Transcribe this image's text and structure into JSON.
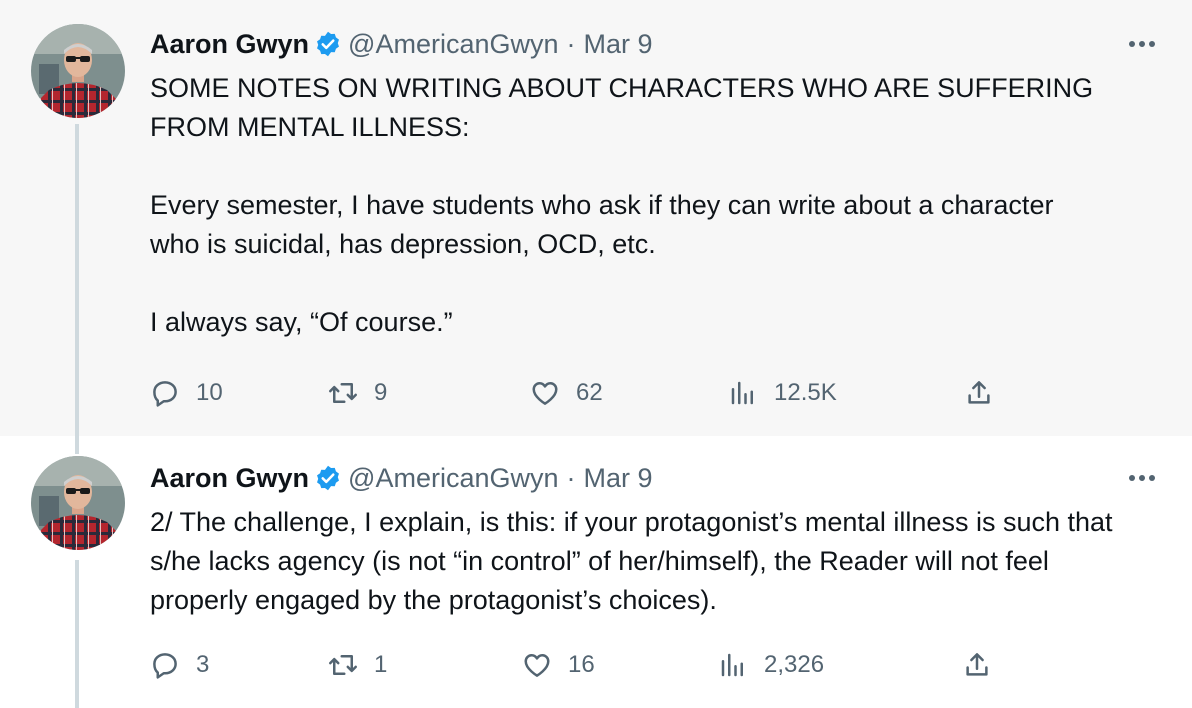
{
  "tweets": [
    {
      "author_name": "Aaron Gwyn",
      "handle": "@AmericanGwyn",
      "separator": "·",
      "date": "Mar 9",
      "paragraphs": [
        "SOME NOTES ON WRITING ABOUT CHARACTERS WHO ARE SUFFERING FROM MENTAL ILLNESS:",
        "Every semester, I have students who ask if they can write about a character who is suicidal, has depression, OCD,  etc.",
        "I always say, “Of course.”"
      ],
      "replies": "10",
      "retweets": "9",
      "likes": "62",
      "views": "12.5K"
    },
    {
      "author_name": "Aaron Gwyn",
      "handle": "@AmericanGwyn",
      "separator": "·",
      "date": "Mar 9",
      "paragraphs": [
        "2/ The challenge, I explain, is this: if your protagonist’s mental illness is such that s/he lacks agency (is not “in control” of her/himself), the Reader will not feel properly engaged by the protagonist’s choices)."
      ],
      "replies": "3",
      "retweets": "1",
      "likes": "16",
      "views": "2,326"
    }
  ],
  "icons": {
    "verified": "verified-badge-icon",
    "more": "more-options-icon",
    "reply": "reply-icon",
    "retweet": "retweet-icon",
    "like": "like-icon",
    "views": "views-icon",
    "share": "share-icon"
  },
  "colors": {
    "first_tweet_background": "#f7f7f7",
    "second_tweet_background": "#ffffff",
    "verified_blue": "#1d9bf0",
    "secondary_text": "#536471",
    "primary_text": "#0f1419",
    "thread_line": "#cfd9de"
  }
}
